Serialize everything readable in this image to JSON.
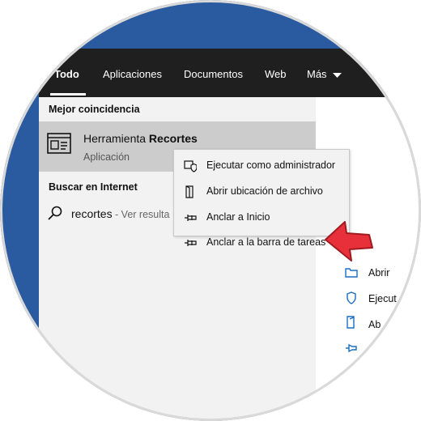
{
  "tabs": [
    {
      "label": "Todo",
      "active": true
    },
    {
      "label": "Aplicaciones"
    },
    {
      "label": "Documentos"
    },
    {
      "label": "Web"
    },
    {
      "label": "Más"
    }
  ],
  "best_match": {
    "section_title": "Mejor coincidencia",
    "app_name_prefix": "Herramienta ",
    "app_name_bold": "Recortes",
    "app_type": "Aplicación"
  },
  "internet": {
    "section_title": "Buscar en Internet",
    "query": "recortes",
    "hint": " - Ver resulta"
  },
  "context_menu": {
    "items": [
      {
        "label": "Ejecutar como administrador",
        "icon": "shield-icon"
      },
      {
        "label": "Abrir ubicación de archivo",
        "icon": "folder-icon"
      },
      {
        "label": "Anclar a Inicio",
        "icon": "pin-icon"
      },
      {
        "label": "Anclar a la barra de tareas",
        "icon": "pin-icon"
      }
    ]
  },
  "right_panel": {
    "items": [
      {
        "label": "Abrir"
      },
      {
        "label": "Ejecut"
      },
      {
        "label": "Ab"
      }
    ]
  },
  "colors": {
    "accent": "#2a5a9f",
    "dark_bar": "#1f1f1f",
    "highlight": "#cccccc",
    "arrow": "#e8303a"
  }
}
